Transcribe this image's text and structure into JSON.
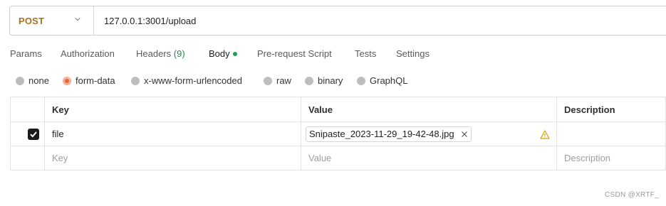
{
  "request": {
    "method": "POST",
    "url": "127.0.0.1:3001/upload"
  },
  "tabs": [
    {
      "label": "Params"
    },
    {
      "label": "Authorization"
    },
    {
      "label": "Headers",
      "count": "(9)"
    },
    {
      "label": "Body",
      "active": true
    },
    {
      "label": "Pre-request Script"
    },
    {
      "label": "Tests"
    },
    {
      "label": "Settings"
    }
  ],
  "body_types": [
    {
      "label": "none"
    },
    {
      "label": "form-data",
      "selected": true
    },
    {
      "label": "x-www-form-urlencoded"
    },
    {
      "label": "raw"
    },
    {
      "label": "binary"
    },
    {
      "label": "GraphQL"
    }
  ],
  "table": {
    "headers": {
      "key": "Key",
      "value": "Value",
      "description": "Description"
    },
    "rows": [
      {
        "checked": true,
        "key": "file",
        "value_file": "Snipaste_2023-11-29_19-42-48.jpg",
        "warning": true
      }
    ],
    "placeholder": {
      "key": "Key",
      "value": "Value",
      "description": "Description"
    }
  },
  "watermark": "CSDN @XRTF_",
  "colors": {
    "method": "#a7741e",
    "radio_selected": "#e8663a",
    "body_dot": "#1f9d55",
    "headers_count": "#1f8a4c",
    "warning": "#d6a21a"
  },
  "icons": [
    "chevron-down-icon",
    "checkmark-icon",
    "close-icon",
    "warning-icon"
  ]
}
